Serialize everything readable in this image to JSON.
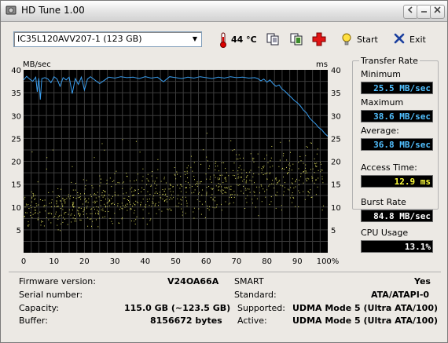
{
  "window": {
    "title": "HD Tune 1.00",
    "buttons": [
      "back",
      "minimize",
      "maximize",
      "close"
    ]
  },
  "toolbar": {
    "drive": "IC35L120AVV207-1 (123 GB)",
    "temperature": "44 °C",
    "start_label": "Start",
    "exit_label": "Exit",
    "icons": [
      "thermometer-icon",
      "copy-icon",
      "copy-text-icon",
      "health-icon",
      "lightbulb-icon",
      "x-icon"
    ]
  },
  "chart": {
    "left_unit": "MB/sec",
    "right_unit": "ms",
    "accent_colors": {
      "transfer": "#3a9ff0",
      "access": "#dede5e",
      "background": "#000000",
      "grid": "#3c3c3c"
    }
  },
  "chart_data": {
    "type": "line",
    "xlabel": "",
    "ylabel": "MB/sec",
    "y2label": "ms",
    "xlim": [
      0,
      100
    ],
    "ylim": [
      0,
      40
    ],
    "y2lim": [
      0,
      40
    ],
    "xtick_labels": [
      "0",
      "10",
      "20",
      "30",
      "40",
      "50",
      "60",
      "70",
      "80",
      "90",
      "100%"
    ],
    "ytick_labels": [
      "5",
      "10",
      "15",
      "20",
      "25",
      "30",
      "35",
      "40"
    ],
    "y2tick_labels": [
      "5",
      "10",
      "15",
      "20",
      "25",
      "30",
      "35",
      "40"
    ],
    "grid": true,
    "series": [
      {
        "kind": "transfer-rate-line",
        "x": [
          0,
          1,
          2,
          3,
          4,
          4.5,
          5,
          5.5,
          6,
          7,
          8,
          9,
          10,
          11,
          12,
          13,
          14,
          15,
          16,
          17,
          18,
          19,
          20,
          21,
          22,
          25,
          28,
          30,
          32,
          34,
          36,
          38,
          40,
          42,
          44,
          46,
          48,
          50,
          52,
          54,
          56,
          58,
          60,
          62,
          64,
          66,
          68,
          70,
          72,
          74,
          76,
          77,
          78,
          79,
          80,
          81,
          82,
          83,
          84,
          85,
          86,
          87,
          88,
          89,
          90,
          91,
          92,
          93,
          94,
          95,
          96,
          97,
          98,
          99,
          100
        ],
        "y": [
          37.8,
          38.6,
          38.0,
          37.5,
          38.4,
          35.2,
          38.2,
          33.5,
          38.1,
          38.3,
          38.0,
          37.2,
          38.5,
          38.0,
          36.4,
          38.3,
          37.8,
          38.4,
          34.8,
          38.1,
          36.8,
          38.4,
          35.6,
          38.0,
          38.5,
          37.0,
          38.4,
          38.2,
          38.5,
          38.3,
          38.4,
          38.1,
          38.5,
          38.2,
          38.4,
          37.4,
          38.5,
          38.3,
          38.1,
          38.4,
          38.2,
          38.5,
          38.3,
          38.1,
          38.4,
          38.2,
          38.5,
          38.3,
          38.4,
          38.2,
          38.3,
          38.1,
          37.6,
          38.0,
          37.3,
          37.8,
          37.0,
          36.4,
          36.7,
          35.8,
          35.3,
          34.6,
          34.0,
          33.3,
          32.8,
          32.1,
          31.2,
          30.6,
          29.5,
          28.8,
          28.2,
          27.4,
          26.9,
          26.1,
          25.5
        ]
      },
      {
        "kind": "access-time-scatter",
        "x_range": [
          0,
          100
        ],
        "y_range": [
          4,
          27
        ],
        "average_ms": 12.9
      }
    ]
  },
  "stats": {
    "transfer_rate_title": "Transfer Rate",
    "minimum_label": "Minimum",
    "minimum_value": "25.5 MB/sec",
    "maximum_label": "Maximum",
    "maximum_value": "38.6 MB/sec",
    "average_label": "Average:",
    "average_value": "36.8 MB/sec",
    "access_time_label": "Access Time:",
    "access_time_value": "12.9 ms",
    "burst_rate_label": "Burst Rate",
    "burst_rate_value": "84.8 MB/sec",
    "cpu_usage_label": "CPU Usage",
    "cpu_usage_value": "13.1%"
  },
  "info": {
    "firmware_label": "Firmware version:",
    "firmware_value": "V24OA66A",
    "serial_label": "Serial number:",
    "serial_value": "",
    "capacity_label": "Capacity:",
    "capacity_value": "115.0 GB (~123.5 GB)",
    "buffer_label": "Buffer:",
    "buffer_value": "8156672 bytes",
    "smart_label": "SMART",
    "smart_value": "Yes",
    "standard_label": "Standard:",
    "standard_value": "ATA/ATAPI-0",
    "supported_label": "Supported:",
    "supported_value": "UDMA Mode 5 (Ultra ATA/100)",
    "active_label": "Active:",
    "active_value": "UDMA Mode 5 (Ultra ATA/100)"
  }
}
